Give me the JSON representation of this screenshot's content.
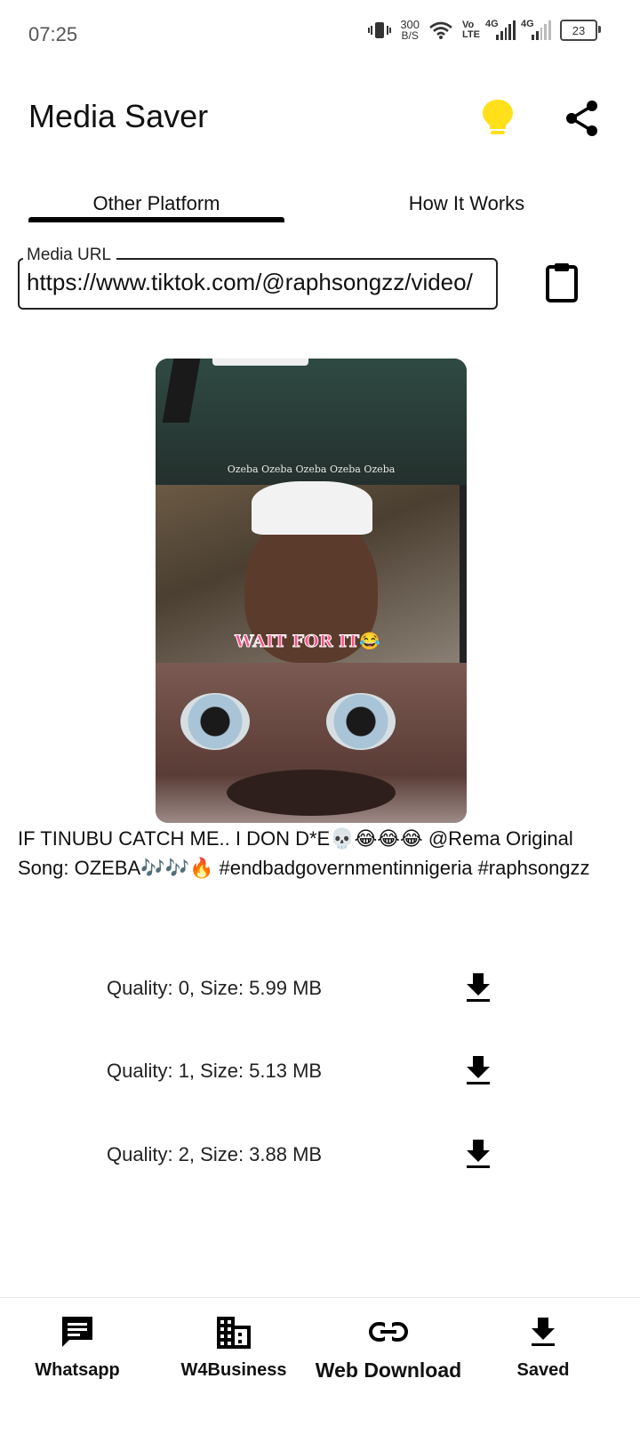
{
  "status_bar": {
    "time": "07:25",
    "net_speed_value": "300",
    "net_speed_unit": "B/S",
    "volte_top": "Vo",
    "volte_bottom": "LTE",
    "sim1_label": "4G",
    "sim2_label": "4G",
    "battery": "23"
  },
  "app_bar": {
    "title": "Media Saver",
    "bulb_icon": "lightbulb-icon",
    "share_icon": "share-icon",
    "bulb_color": "#FFE01B"
  },
  "tabs": [
    {
      "label": "Other Platform",
      "selected": true
    },
    {
      "label": "How It Works",
      "selected": false
    }
  ],
  "url_field": {
    "label": "Media URL",
    "value": "https://www.tiktok.com/@raphsongzz/video/",
    "paste_icon": "clipboard-icon"
  },
  "thumbnail": {
    "caption_top": "Ozeba Ozeba Ozeba Ozeba Ozeba",
    "caption_mid": "WAIT FOR IT😂"
  },
  "media_caption": "IF TINUBU CATCH ME.. I DON D*E💀😂😂😂 @Rema Original Song: OZEBA🎶🎶🔥 #endbadgovernmentinnigeria #raphsongzz",
  "qualities": [
    {
      "label": "Quality: 0, Size: 5.99 MB",
      "icon": "download-icon"
    },
    {
      "label": "Quality: 1, Size: 5.13 MB",
      "icon": "download-icon"
    },
    {
      "label": "Quality: 2, Size: 3.88 MB",
      "icon": "download-icon"
    }
  ],
  "bottom_nav": [
    {
      "label": "Whatsapp",
      "icon": "message-icon"
    },
    {
      "label": "W4Business",
      "icon": "business-icon"
    },
    {
      "label": "Web Download",
      "icon": "link-icon",
      "selected": true
    },
    {
      "label": "Saved",
      "icon": "download-icon"
    }
  ]
}
